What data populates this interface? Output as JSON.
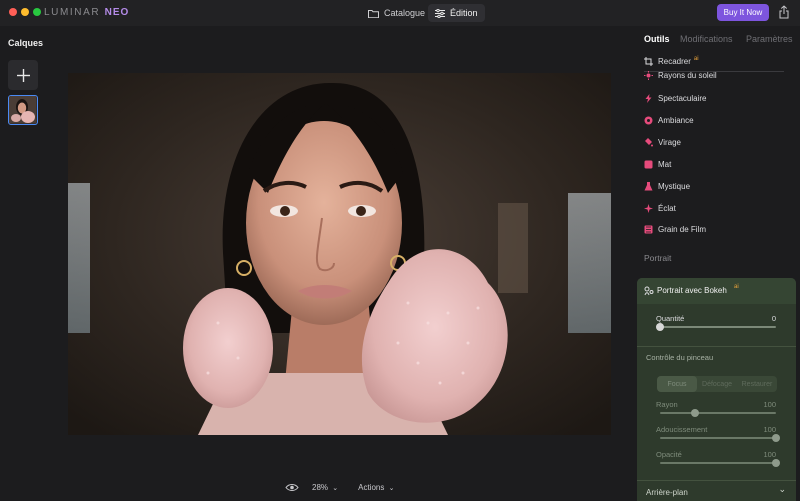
{
  "titlebar": {
    "logo_luminar": "LUMINAR",
    "logo_neo": "NEO",
    "catalogue_label": "Catalogue",
    "edition_label": "Édition",
    "buy_label": "Buy It Now",
    "colors": {
      "close": "#ff5f57",
      "minimize": "#febc2e",
      "maximize": "#28c840",
      "accent": "#7d55de"
    }
  },
  "layers": {
    "title": "Calques",
    "add_icon": "plus-icon"
  },
  "right_panel": {
    "tabs": [
      {
        "label": "Outils",
        "active": true
      },
      {
        "label": "Modifications",
        "active": false
      },
      {
        "label": "Paramètres",
        "active": false
      }
    ],
    "tools": [
      {
        "label": "Recadrer",
        "ai": true,
        "icon": "crop-icon"
      },
      {
        "label": "Rayons du soleil",
        "icon": "sunrays-icon"
      },
      {
        "label": "Spectaculaire",
        "icon": "lightning-icon"
      },
      {
        "label": "Ambiance",
        "icon": "ambiance-icon"
      },
      {
        "label": "Virage",
        "icon": "bucket-icon"
      },
      {
        "label": "Mat",
        "icon": "square-icon"
      },
      {
        "label": "Mystique",
        "icon": "flask-icon"
      },
      {
        "label": "Éclat",
        "icon": "sparkle-icon"
      },
      {
        "label": "Grain de Film",
        "icon": "film-icon"
      }
    ],
    "section_portrait": "Portrait",
    "bokeh": {
      "title": "Portrait avec Bokeh",
      "ai_badge": "ai",
      "amount_label": "Quantité",
      "amount_value": "0",
      "amount_level": 0,
      "brush_title": "Contrôle du pinceau",
      "modes": [
        "Focus",
        "Défocage",
        "Restaurer"
      ],
      "sliders": [
        {
          "label": "Rayon",
          "value": "100",
          "level": 0.3
        },
        {
          "label": "Adoucissement",
          "value": "100",
          "level": 1.0
        },
        {
          "label": "Opacité",
          "value": "100",
          "level": 1.0
        }
      ],
      "background_label": "Arrière-plan"
    }
  },
  "bottombar": {
    "zoom": "28%",
    "actions_label": "Actions"
  }
}
